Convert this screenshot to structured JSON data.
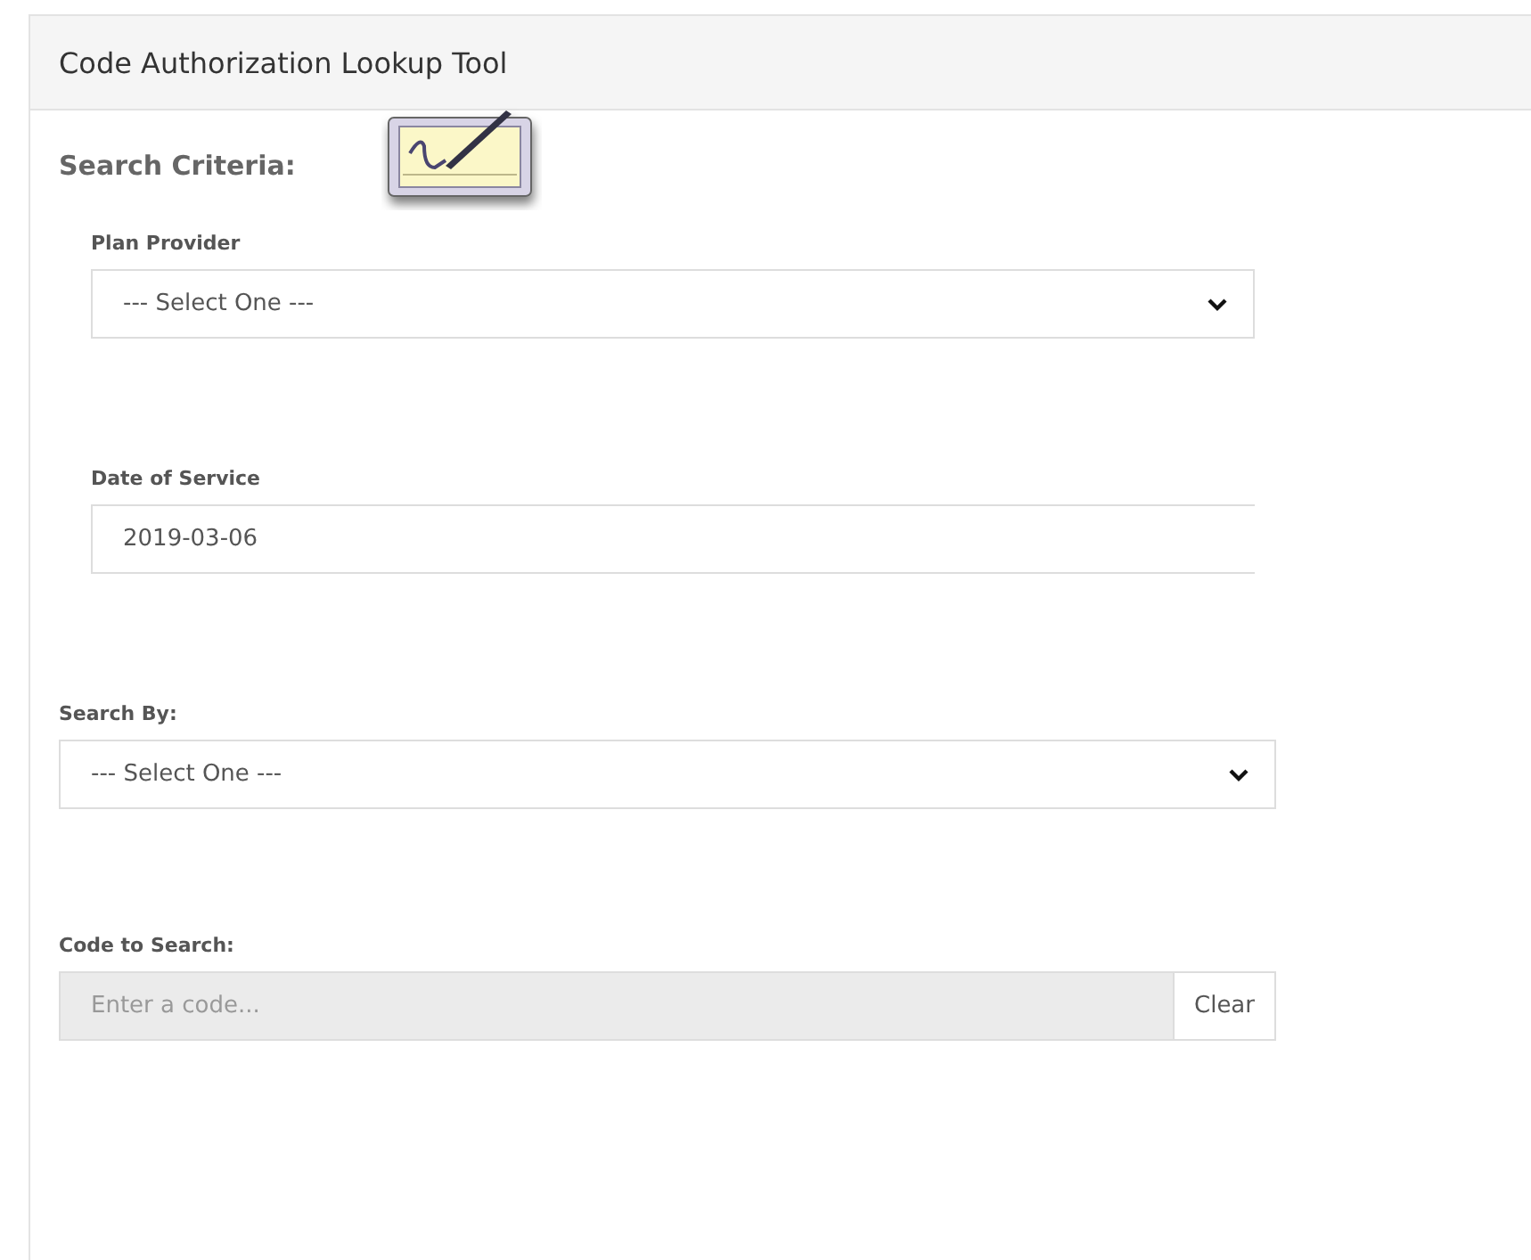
{
  "panel": {
    "title": "Code Authorization Lookup Tool"
  },
  "criteria": {
    "heading": "Search Criteria:",
    "fields": [
      {
        "kind": "select",
        "label": "Plan Provider",
        "value": "--- Select One ---"
      },
      {
        "kind": "text",
        "label": "Date of Service",
        "value": "2019-03-06"
      }
    ]
  },
  "search_fields": [
    {
      "kind": "select",
      "label": "Search By:",
      "value": "--- Select One ---"
    },
    {
      "kind": "code",
      "label": "Code to Search:",
      "placeholder": "Enter a code...",
      "disabled": true,
      "button": "Clear"
    }
  ]
}
